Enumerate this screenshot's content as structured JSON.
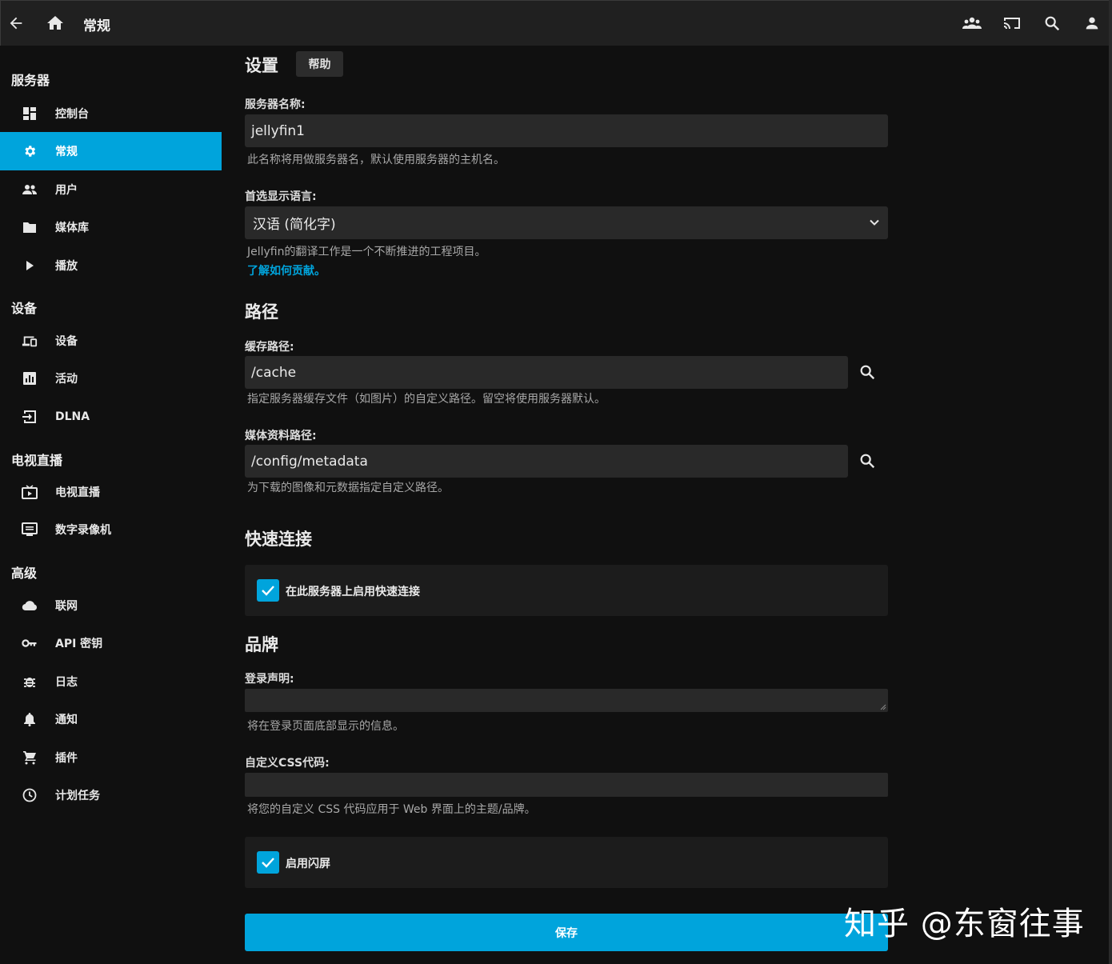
{
  "header": {
    "title": "常规",
    "icons": [
      "back-arrow-icon",
      "home-icon",
      "users-icon",
      "cast-icon",
      "search-icon",
      "user-icon"
    ]
  },
  "sidebar": {
    "sections": [
      {
        "heading": "服务器",
        "items": [
          {
            "label": "控制台",
            "icon": "dashboard-icon"
          },
          {
            "label": "常规",
            "icon": "gear-icon",
            "active": true
          },
          {
            "label": "用户",
            "icon": "people-icon"
          },
          {
            "label": "媒体库",
            "icon": "folder-icon"
          },
          {
            "label": "播放",
            "icon": "play-icon"
          }
        ]
      },
      {
        "heading": "设备",
        "items": [
          {
            "label": "设备",
            "icon": "devices-icon"
          },
          {
            "label": "活动",
            "icon": "chart-icon"
          },
          {
            "label": "DLNA",
            "icon": "input-icon"
          }
        ]
      },
      {
        "heading": "电视直播",
        "items": [
          {
            "label": "电视直播",
            "icon": "live-tv-icon"
          },
          {
            "label": "数字录像机",
            "icon": "dvr-icon"
          }
        ]
      },
      {
        "heading": "高级",
        "items": [
          {
            "label": "联网",
            "icon": "cloud-icon"
          },
          {
            "label": "API 密钥",
            "icon": "key-icon"
          },
          {
            "label": "日志",
            "icon": "bug-icon"
          },
          {
            "label": "通知",
            "icon": "bell-icon"
          },
          {
            "label": "插件",
            "icon": "cart-icon"
          },
          {
            "label": "计划任务",
            "icon": "clock-icon"
          }
        ]
      }
    ]
  },
  "settings": {
    "title": "设置",
    "help": "帮助",
    "server_name_label": "服务器名称:",
    "server_name_value": "jellyfin1",
    "server_name_hint": "此名称将用做服务器名，默认使用服务器的主机名。",
    "language_label": "首选显示语言:",
    "language_value": "汉语 (简化字)",
    "language_hint": "Jellyfin的翻译工作是一个不断推进的工程项目。",
    "language_link": "了解如何贡献。"
  },
  "paths": {
    "title": "路径",
    "cache_label": "缓存路径:",
    "cache_value": "/cache",
    "cache_hint": "指定服务器缓存文件（如图片）的自定义路径。留空将使用服务器默认。",
    "metadata_label": "媒体资料路径:",
    "metadata_value": "/config/metadata",
    "metadata_hint": "为下载的图像和元数据指定自定义路径。"
  },
  "quickconnect": {
    "title": "快速连接",
    "checkbox_label": "在此服务器上启用快速连接",
    "checked": true
  },
  "branding": {
    "title": "品牌",
    "login_label": "登录声明:",
    "login_value": "",
    "login_hint": "将在登录页面底部显示的信息。",
    "css_label": "自定义CSS代码:",
    "css_value": "",
    "css_hint": "将您的自定义 CSS 代码应用于 Web 界面上的主题/品牌。",
    "splash_label": "启用闪屏",
    "splash_checked": true
  },
  "save_label": "保存",
  "watermark": "知乎 @东窗往事",
  "colors": {
    "accent": "#00a4dc",
    "background": "#101010",
    "header": "#202020",
    "input": "#292929"
  }
}
